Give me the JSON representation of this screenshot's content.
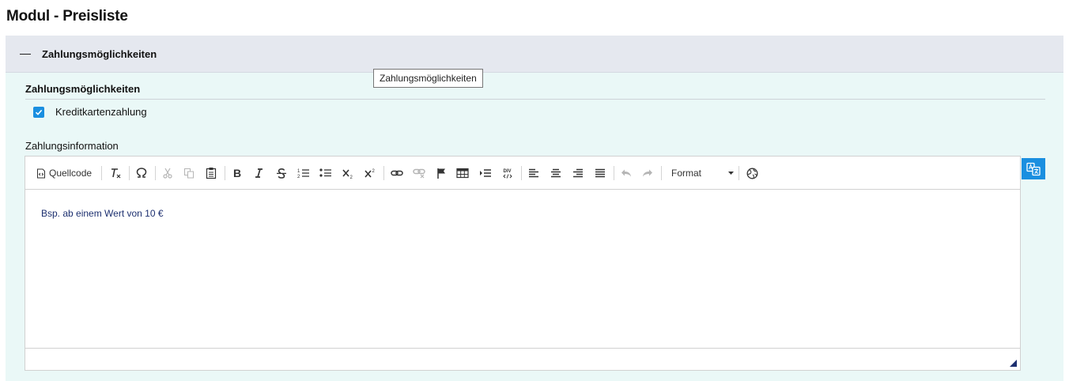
{
  "page": {
    "title": "Modul - Preisliste"
  },
  "accordion": {
    "header_label": "Zahlungsmöglichkeiten",
    "tooltip": "Zahlungsmöglichkeiten"
  },
  "section": {
    "title": "Zahlungsmöglichkeiten",
    "checkbox": {
      "label": "Kreditkartenzahlung",
      "checked": true
    },
    "field_label": "Zahlungsinformation"
  },
  "editor": {
    "toolbar": {
      "source_label": "Quellcode",
      "format_label": "Format",
      "buttons": [
        "source-icon",
        "remove-format-icon",
        "special-char-icon",
        "cut-icon",
        "copy-icon",
        "paste-icon",
        "bold-icon",
        "italic-icon",
        "strike-icon",
        "ordered-list-icon",
        "bullet-list-icon",
        "subscript-icon",
        "superscript-icon",
        "link-icon",
        "unlink-icon",
        "anchor-icon",
        "table-icon",
        "indent-icon",
        "div-icon",
        "align-left-icon",
        "align-center-icon",
        "align-right-icon",
        "justify-icon",
        "undo-icon",
        "redo-icon",
        "format-dropdown",
        "globe-icon"
      ]
    },
    "content": "Bsp. ab einem Wert von 10 €"
  },
  "colors": {
    "accent": "#1a8fe0",
    "header_bg": "#e5e8ef",
    "body_bg": "#eaf8f7",
    "content_text": "#1c2f6f"
  }
}
